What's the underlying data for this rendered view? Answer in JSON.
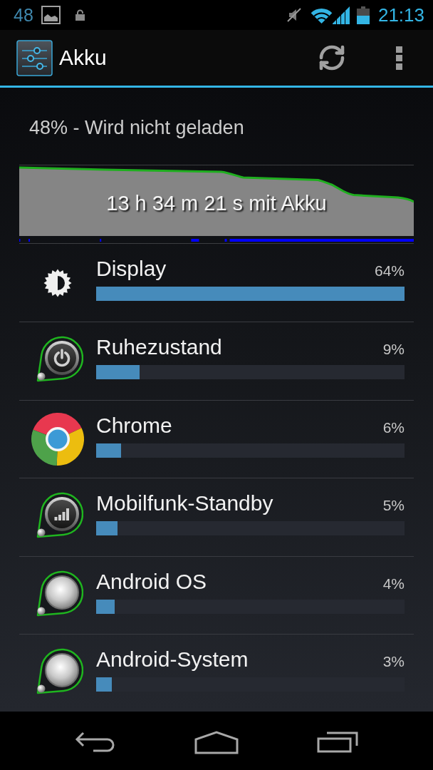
{
  "status_bar": {
    "notification_count": "48",
    "time": "21:13"
  },
  "action_bar": {
    "title": "Akku"
  },
  "battery_status": "48% - Wird nicht geladen",
  "history_graph": {
    "caption": "13 h 34 m 21 s mit Akku"
  },
  "usage": [
    {
      "kind": "brightness",
      "name": "Display",
      "percent": "64%",
      "level": 1
    },
    {
      "kind": "power",
      "name": "Ruhezustand",
      "percent": "9%",
      "level": 0.14
    },
    {
      "kind": "browser",
      "name": "Chrome",
      "percent": "6%",
      "level": 0.08
    },
    {
      "kind": "signal",
      "name": "Mobilfunk-Standby",
      "percent": "5%",
      "level": 0.07
    },
    {
      "kind": "system",
      "name": "Android OS",
      "percent": "4%",
      "level": 0.06
    },
    {
      "kind": "system",
      "name": "Android-System",
      "percent": "3%",
      "level": 0.05
    }
  ]
}
